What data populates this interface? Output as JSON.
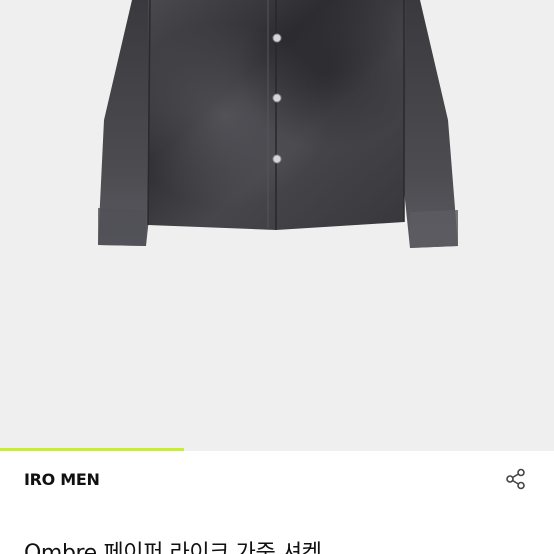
{
  "gallery": {
    "image_alt": "Ombre 페이퍼 라이크 가죽 셔켓",
    "progress": 0.333
  },
  "product": {
    "brand": "IRO MEN",
    "title": "Ombre 페이퍼 라이크 가죽 셔켓"
  },
  "icons": {
    "share": "share-icon"
  },
  "colors": {
    "background": "#efefef",
    "progress_accent": "#c8ef2d",
    "text": "#111111",
    "garment": "#3e3e42"
  }
}
